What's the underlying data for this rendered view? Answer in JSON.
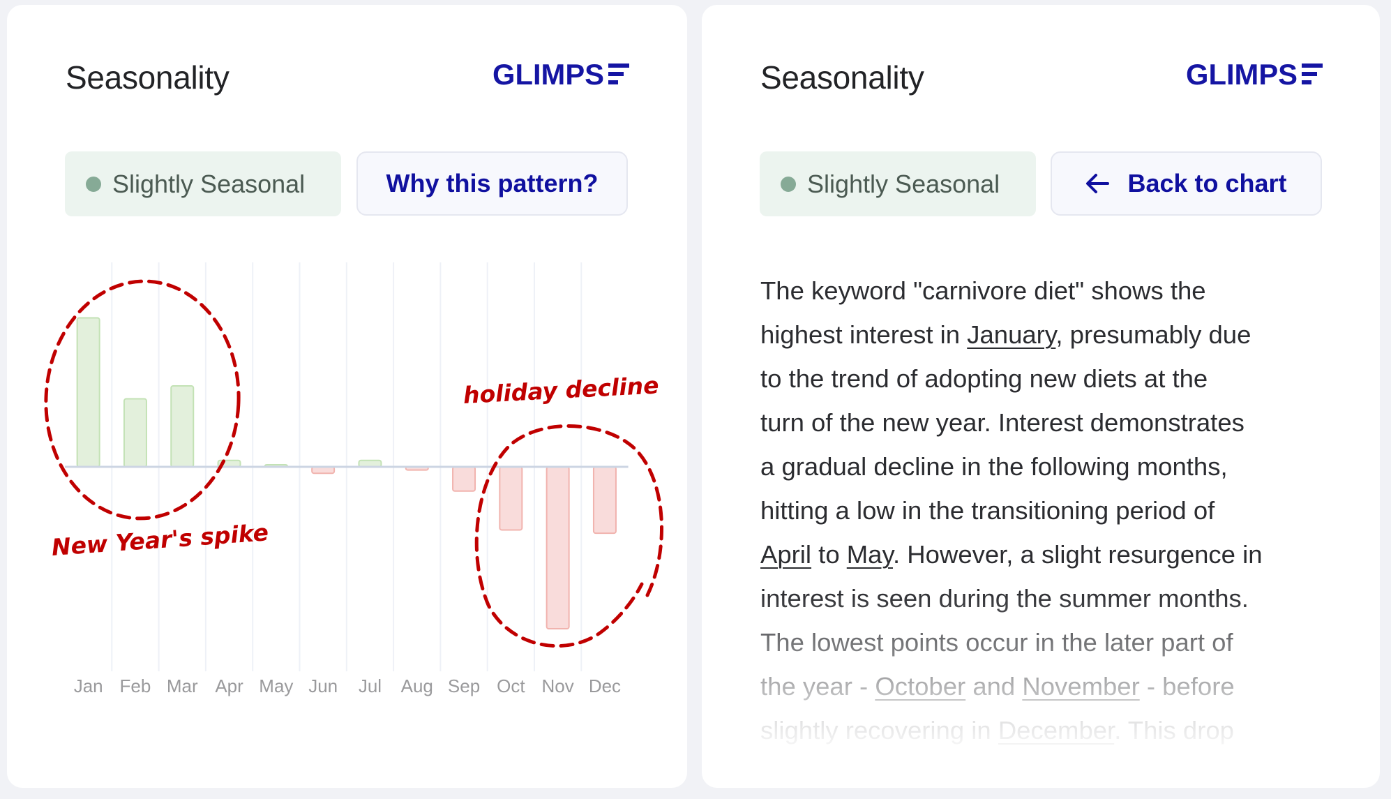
{
  "left_panel": {
    "title": "Seasonality",
    "logo_text": "GLIMPS",
    "badge": {
      "label": "Slightly Seasonal",
      "dot_color": "#86aa96"
    },
    "action_button": {
      "label": "Why this pattern?"
    },
    "annotations": {
      "left": "New Year's spike",
      "right": "holiday decline"
    }
  },
  "right_panel": {
    "title": "Seasonality",
    "logo_text": "GLIMPS",
    "badge": {
      "label": "Slightly Seasonal",
      "dot_color": "#86aa96"
    },
    "back_button": {
      "label": "Back to chart",
      "icon": "arrow-left-icon"
    },
    "explanation_lines": [
      [
        {
          "t": "The keyword \"carnivore diet\" shows the"
        }
      ],
      [
        {
          "t": "highest interest in "
        },
        {
          "t": "January",
          "link": true
        },
        {
          "t": ", presumably due"
        }
      ],
      [
        {
          "t": "to the trend of adopting new diets at the"
        }
      ],
      [
        {
          "t": "turn of the new year. Interest demonstrates"
        }
      ],
      [
        {
          "t": "a gradual decline in the following months,"
        }
      ],
      [
        {
          "t": "hitting a low in the transitioning period of"
        }
      ],
      [
        {
          "t": "April",
          "link": true
        },
        {
          "t": " to "
        },
        {
          "t": "May",
          "link": true
        },
        {
          "t": ". However, a slight resurgence in"
        }
      ],
      [
        {
          "t": "interest is seen during the summer months."
        }
      ],
      [
        {
          "t": "The lowest points occur in the later part of"
        }
      ],
      [
        {
          "t": "the year - "
        },
        {
          "t": "October",
          "link": true
        },
        {
          "t": " and "
        },
        {
          "t": "November",
          "link": true
        },
        {
          "t": " - before"
        }
      ],
      [
        {
          "t": "slightly recovering in "
        },
        {
          "t": "December",
          "link": true
        },
        {
          "t": ". This drop"
        }
      ]
    ]
  },
  "colors": {
    "brand": "#1515a3",
    "positive_fill": "#e3f0dc",
    "positive_stroke": "#c3e2b5",
    "negative_fill": "#f9dcdb",
    "negative_stroke": "#f1b3ae",
    "annotation": "#c00000",
    "zero_line": "#ccd5e3",
    "grid": "#eef1f7",
    "tick_label": "#9a9a9c"
  },
  "chart_data": {
    "type": "bar",
    "title": "Seasonality",
    "categories": [
      "Jan",
      "Feb",
      "Mar",
      "Apr",
      "May",
      "Jun",
      "Jul",
      "Aug",
      "Sep",
      "Oct",
      "Nov",
      "Dec"
    ],
    "values": [
      92,
      42,
      50,
      4,
      0.5,
      -4,
      4,
      -2,
      -15,
      -39,
      -100,
      -41
    ],
    "value_note": "relative seasonal index (no axis scale shown)",
    "ylim": [
      -125,
      125
    ],
    "grid": "vertical",
    "xlabel": "",
    "ylabel": "",
    "annotations": [
      {
        "text": "New Year's spike",
        "highlights": [
          "Jan",
          "Feb",
          "Mar"
        ]
      },
      {
        "text": "holiday decline",
        "highlights": [
          "Oct",
          "Nov",
          "Dec"
        ]
      }
    ]
  }
}
